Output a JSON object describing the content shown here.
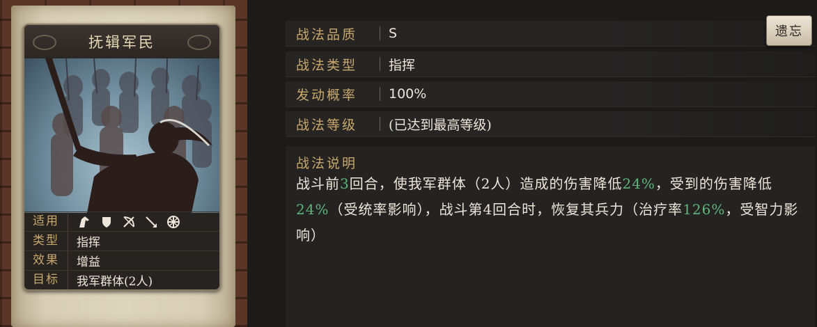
{
  "card": {
    "title": "抚辑军民",
    "info": [
      {
        "key": "适用",
        "value": ""
      },
      {
        "key": "类型",
        "value": "指挥"
      },
      {
        "key": "效果",
        "value": "增益"
      },
      {
        "key": "目标",
        "value": "我军群体(2人)"
      }
    ],
    "unit_icons": [
      "cavalry-icon",
      "shield-icon",
      "bow-icon",
      "spear-icon",
      "wheel-icon"
    ]
  },
  "stats": [
    {
      "key": "战法品质",
      "value": "S"
    },
    {
      "key": "战法类型",
      "value": "指挥"
    },
    {
      "key": "发动概率",
      "value": "100%"
    },
    {
      "key": "战法等级",
      "value": "(已达到最高等级)"
    }
  ],
  "forget_button": "遗忘",
  "description": {
    "title": "战法说明",
    "segments": [
      {
        "text": "战斗前",
        "hl": false
      },
      {
        "text": "3",
        "hl": true
      },
      {
        "text": "回合，使我军群体（2人）造成的伤害降低",
        "hl": false
      },
      {
        "text": "24%",
        "hl": true
      },
      {
        "text": "，受到的伤害降低",
        "hl": false
      },
      {
        "text": "24%",
        "hl": true
      },
      {
        "text": "（受统率影响），战斗第4回合时，恢复其兵力（治疗率",
        "hl": false
      },
      {
        "text": "126%",
        "hl": true
      },
      {
        "text": "，受智力影响）",
        "hl": false
      }
    ]
  },
  "colors": {
    "label_gold": "#c9a86b",
    "highlight_green": "#5fb67c",
    "text": "#ece6da"
  }
}
